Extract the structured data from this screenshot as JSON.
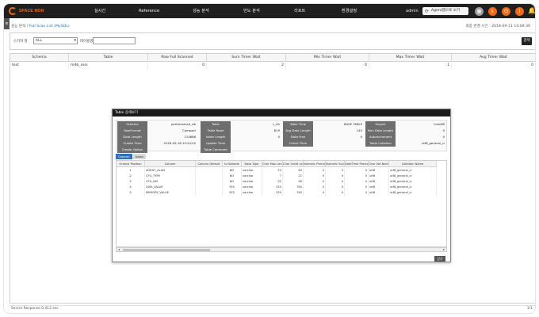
{
  "header": {
    "logo_text": "SPACE MON",
    "nav": [
      "실시간",
      "Reference",
      "성능 분석",
      "빈도 분석",
      "리포트",
      "환경설정"
    ],
    "user": "admin",
    "agent_button": "Agent맵으로 보기",
    "circle_colors": [
      "#9e9e9e",
      "#f06a1c",
      "#f06a1c",
      "#f06a1c"
    ]
  },
  "breadcrumb": {
    "prefix": "성능 분석 / ",
    "current": "Full Scan List (MySQL)"
  },
  "timestamp": "최종 변경 시간 : 2018-09-11 14:09:30",
  "search": {
    "schema_label": "스키마 명",
    "schema_value": "ALL",
    "table_label": "테이블명",
    "table_value": "",
    "search_button": "검색"
  },
  "main_table": {
    "columns": [
      "Schema",
      "Table",
      "Row Full Scanned",
      "Sum Timer Wait",
      "Min Timer Wait",
      "Max Timer Wait",
      "Avg Timer Wait"
    ],
    "rows": [
      [
        "test",
        "mdb_ssoi",
        "0",
        "2",
        "0",
        "1",
        "0"
      ]
    ]
  },
  "status": {
    "text": "Server Response 0.413 sec",
    "page": "1/1"
  },
  "modal": {
    "title": "Table 상세보기",
    "info": [
      [
        [
          "Schema",
          "performance_db"
        ],
        [
          "Table",
          "t_cfs"
        ],
        [
          "Table Time",
          "BASE TABLE"
        ],
        [
          "Engine",
          "InnoDB"
        ]
      ],
      [
        [
          "RowFormat",
          "Compact"
        ],
        [
          "Table Rows",
          "819"
        ],
        [
          "Avg Data Length",
          "140"
        ],
        [
          "Max Data Length",
          "0"
        ]
      ],
      [
        [
          "Data Length",
          "114688"
        ],
        [
          "Index Length",
          "0"
        ],
        [
          "Data Free",
          "0"
        ],
        [
          "AutoIncrement",
          "0"
        ]
      ],
      [
        [
          "Create Time",
          "2018-05-18 15:24:50"
        ],
        [
          "Update Time",
          ""
        ],
        [
          "Check Time",
          ""
        ],
        [
          "Table Collation",
          "utf8_general_ci"
        ]
      ],
      [
        [
          "Create Option",
          ""
        ],
        [
          "Table Comment",
          ""
        ]
      ]
    ],
    "tabs": [
      "Column",
      "Index"
    ],
    "col_headers": [
      "Ordinal Position",
      "Column",
      "Column Default",
      "Is Nullable",
      "Data Type",
      "Char Max Length",
      "Char Octet Length",
      "Numeric Precision",
      "Numeric Scale",
      "DateTime Precision",
      "Char Set Name",
      "Collation Name"
    ],
    "col_rows": [
      [
        "1",
        "AGENT_ALIAS",
        "",
        "NO",
        "varchar",
        "20",
        "60",
        "0",
        "0",
        "0",
        "utf8",
        "utf8_general_ci"
      ],
      [
        "2",
        "CFG_TYPE",
        "",
        "NO",
        "varchar",
        "7",
        "21",
        "0",
        "0",
        "0",
        "utf8",
        "utf8_general_ci"
      ],
      [
        "3",
        "CFG_NM",
        "",
        "NO",
        "varchar",
        "32",
        "96",
        "0",
        "0",
        "0",
        "utf8",
        "utf8_general_ci"
      ],
      [
        "4",
        "DISK_VALUE",
        "",
        "YES",
        "varchar",
        "255",
        "765",
        "0",
        "0",
        "0",
        "utf8",
        "utf8_general_ci"
      ],
      [
        "5",
        "MEMORY_VALUE",
        "",
        "YES",
        "varchar",
        "255",
        "765",
        "0",
        "0",
        "0",
        "utf8",
        "utf8_general_ci"
      ]
    ],
    "close_button": "닫기"
  }
}
